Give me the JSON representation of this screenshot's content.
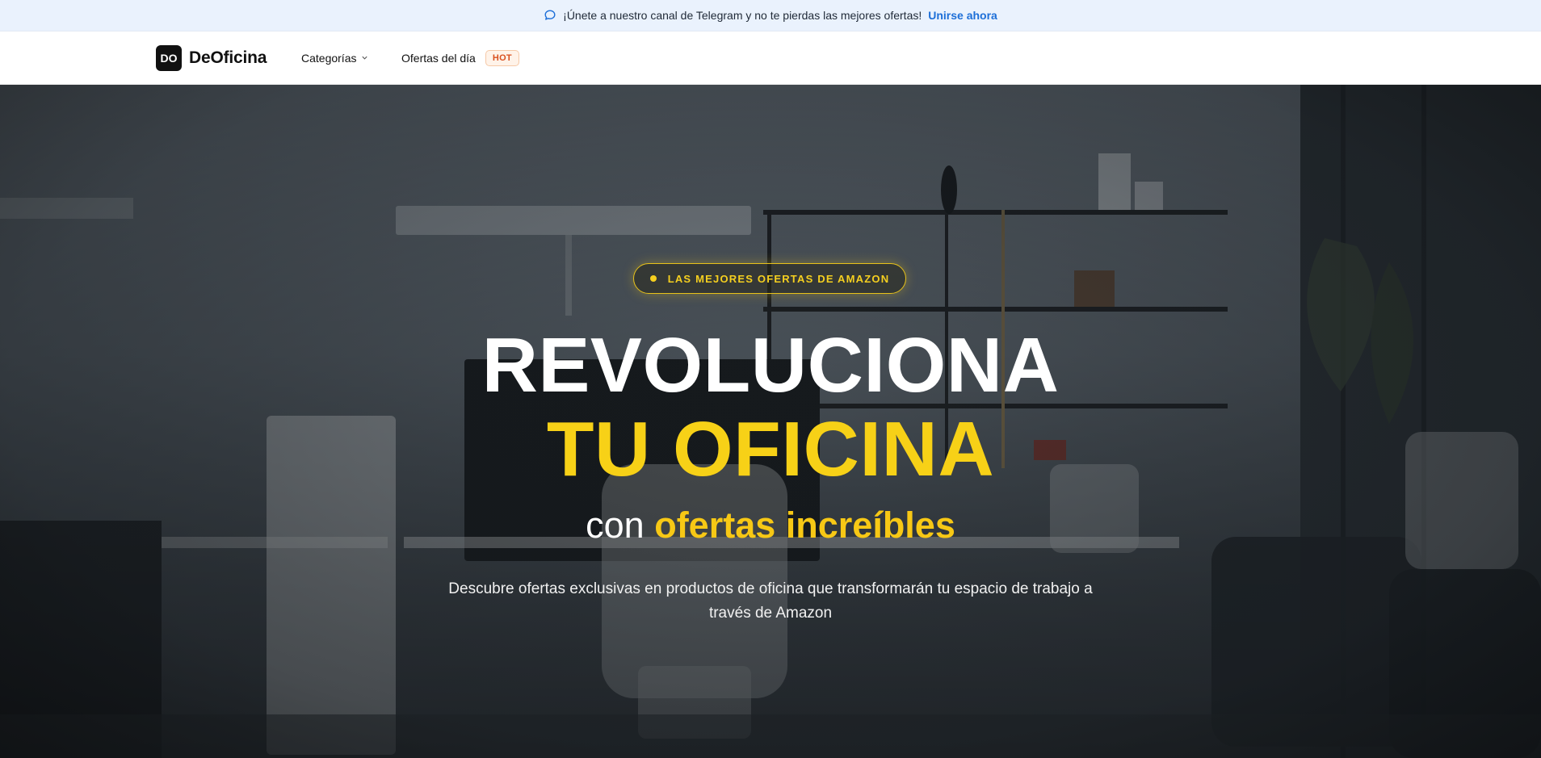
{
  "announcement": {
    "text": "¡Únete a nuestro canal de Telegram y no te pierdas las mejores ofertas!",
    "link": "Unirse ahora",
    "icon": "chat-bubble-icon"
  },
  "nav": {
    "logo_text": "DO",
    "brand": "DeOficina",
    "categories": "Categorías",
    "deals": "Ofertas del día",
    "hot_badge": "HOT"
  },
  "hero": {
    "badge": "LAS MEJORES OFERTAS DE AMAZON",
    "title_line1": "REVOLUCIONA",
    "title_line2": "TU OFICINA",
    "subtitle_prefix": "con ",
    "subtitle_highlight": "ofertas increíbles",
    "description": "Descubre ofertas exclusivas en productos de oficina que transformarán tu espacio de trabajo a través de Amazon",
    "background": "office-interior-photo"
  },
  "colors": {
    "accent_yellow": "#f7d117",
    "link_blue": "#1d6fd8",
    "hot_orange": "#d9501e",
    "announce_bg": "#eaf2fd"
  }
}
